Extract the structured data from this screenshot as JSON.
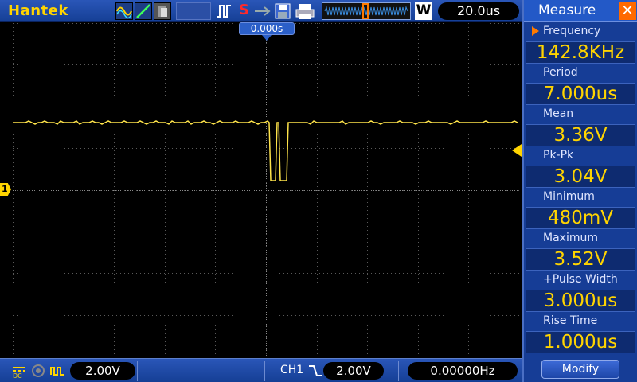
{
  "brand": "Hantek",
  "status": {
    "run_stop_indicator": "S",
    "timebase": "20.0us",
    "zoom_indicator": "W"
  },
  "screen": {
    "trigger_time": "0.000s",
    "ch1_marker": "1",
    "trace_color": "#ffe44a",
    "grid_color": "#5a5a5a"
  },
  "bottom": {
    "ch1_volts_div": "2.00V",
    "ch1_label": "CH1",
    "trigger_level": "2.00V",
    "trigger_frequency": "0.00000Hz"
  },
  "measure": {
    "title": "Measure",
    "close_icon": "close-icon",
    "items": [
      {
        "label": "Frequency",
        "value": "142.8KHz"
      },
      {
        "label": "Period",
        "value": "7.000us"
      },
      {
        "label": "Mean",
        "value": "3.36V"
      },
      {
        "label": "Pk-Pk",
        "value": "3.04V"
      },
      {
        "label": "Minimum",
        "value": "480mV"
      },
      {
        "label": "Maximum",
        "value": "3.52V"
      },
      {
        "label": "+Pulse Width",
        "value": "3.000us"
      },
      {
        "label": "Rise Time",
        "value": "1.000us"
      }
    ],
    "modify_label": "Modify"
  },
  "colors": {
    "accent": "#ffd400",
    "panel": "#163d96",
    "bar": "#2a56b8",
    "close": "#ff6a00"
  }
}
